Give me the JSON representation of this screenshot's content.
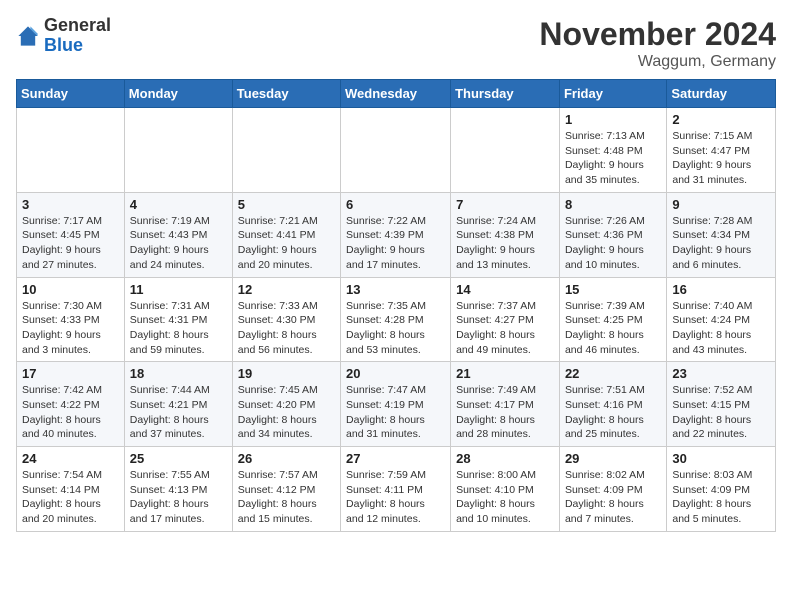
{
  "logo": {
    "general": "General",
    "blue": "Blue"
  },
  "title": "November 2024",
  "location": "Waggum, Germany",
  "days_of_week": [
    "Sunday",
    "Monday",
    "Tuesday",
    "Wednesday",
    "Thursday",
    "Friday",
    "Saturday"
  ],
  "weeks": [
    [
      {
        "day": "",
        "info": ""
      },
      {
        "day": "",
        "info": ""
      },
      {
        "day": "",
        "info": ""
      },
      {
        "day": "",
        "info": ""
      },
      {
        "day": "",
        "info": ""
      },
      {
        "day": "1",
        "info": "Sunrise: 7:13 AM\nSunset: 4:48 PM\nDaylight: 9 hours and 35 minutes."
      },
      {
        "day": "2",
        "info": "Sunrise: 7:15 AM\nSunset: 4:47 PM\nDaylight: 9 hours and 31 minutes."
      }
    ],
    [
      {
        "day": "3",
        "info": "Sunrise: 7:17 AM\nSunset: 4:45 PM\nDaylight: 9 hours and 27 minutes."
      },
      {
        "day": "4",
        "info": "Sunrise: 7:19 AM\nSunset: 4:43 PM\nDaylight: 9 hours and 24 minutes."
      },
      {
        "day": "5",
        "info": "Sunrise: 7:21 AM\nSunset: 4:41 PM\nDaylight: 9 hours and 20 minutes."
      },
      {
        "day": "6",
        "info": "Sunrise: 7:22 AM\nSunset: 4:39 PM\nDaylight: 9 hours and 17 minutes."
      },
      {
        "day": "7",
        "info": "Sunrise: 7:24 AM\nSunset: 4:38 PM\nDaylight: 9 hours and 13 minutes."
      },
      {
        "day": "8",
        "info": "Sunrise: 7:26 AM\nSunset: 4:36 PM\nDaylight: 9 hours and 10 minutes."
      },
      {
        "day": "9",
        "info": "Sunrise: 7:28 AM\nSunset: 4:34 PM\nDaylight: 9 hours and 6 minutes."
      }
    ],
    [
      {
        "day": "10",
        "info": "Sunrise: 7:30 AM\nSunset: 4:33 PM\nDaylight: 9 hours and 3 minutes."
      },
      {
        "day": "11",
        "info": "Sunrise: 7:31 AM\nSunset: 4:31 PM\nDaylight: 8 hours and 59 minutes."
      },
      {
        "day": "12",
        "info": "Sunrise: 7:33 AM\nSunset: 4:30 PM\nDaylight: 8 hours and 56 minutes."
      },
      {
        "day": "13",
        "info": "Sunrise: 7:35 AM\nSunset: 4:28 PM\nDaylight: 8 hours and 53 minutes."
      },
      {
        "day": "14",
        "info": "Sunrise: 7:37 AM\nSunset: 4:27 PM\nDaylight: 8 hours and 49 minutes."
      },
      {
        "day": "15",
        "info": "Sunrise: 7:39 AM\nSunset: 4:25 PM\nDaylight: 8 hours and 46 minutes."
      },
      {
        "day": "16",
        "info": "Sunrise: 7:40 AM\nSunset: 4:24 PM\nDaylight: 8 hours and 43 minutes."
      }
    ],
    [
      {
        "day": "17",
        "info": "Sunrise: 7:42 AM\nSunset: 4:22 PM\nDaylight: 8 hours and 40 minutes."
      },
      {
        "day": "18",
        "info": "Sunrise: 7:44 AM\nSunset: 4:21 PM\nDaylight: 8 hours and 37 minutes."
      },
      {
        "day": "19",
        "info": "Sunrise: 7:45 AM\nSunset: 4:20 PM\nDaylight: 8 hours and 34 minutes."
      },
      {
        "day": "20",
        "info": "Sunrise: 7:47 AM\nSunset: 4:19 PM\nDaylight: 8 hours and 31 minutes."
      },
      {
        "day": "21",
        "info": "Sunrise: 7:49 AM\nSunset: 4:17 PM\nDaylight: 8 hours and 28 minutes."
      },
      {
        "day": "22",
        "info": "Sunrise: 7:51 AM\nSunset: 4:16 PM\nDaylight: 8 hours and 25 minutes."
      },
      {
        "day": "23",
        "info": "Sunrise: 7:52 AM\nSunset: 4:15 PM\nDaylight: 8 hours and 22 minutes."
      }
    ],
    [
      {
        "day": "24",
        "info": "Sunrise: 7:54 AM\nSunset: 4:14 PM\nDaylight: 8 hours and 20 minutes."
      },
      {
        "day": "25",
        "info": "Sunrise: 7:55 AM\nSunset: 4:13 PM\nDaylight: 8 hours and 17 minutes."
      },
      {
        "day": "26",
        "info": "Sunrise: 7:57 AM\nSunset: 4:12 PM\nDaylight: 8 hours and 15 minutes."
      },
      {
        "day": "27",
        "info": "Sunrise: 7:59 AM\nSunset: 4:11 PM\nDaylight: 8 hours and 12 minutes."
      },
      {
        "day": "28",
        "info": "Sunrise: 8:00 AM\nSunset: 4:10 PM\nDaylight: 8 hours and 10 minutes."
      },
      {
        "day": "29",
        "info": "Sunrise: 8:02 AM\nSunset: 4:09 PM\nDaylight: 8 hours and 7 minutes."
      },
      {
        "day": "30",
        "info": "Sunrise: 8:03 AM\nSunset: 4:09 PM\nDaylight: 8 hours and 5 minutes."
      }
    ]
  ]
}
